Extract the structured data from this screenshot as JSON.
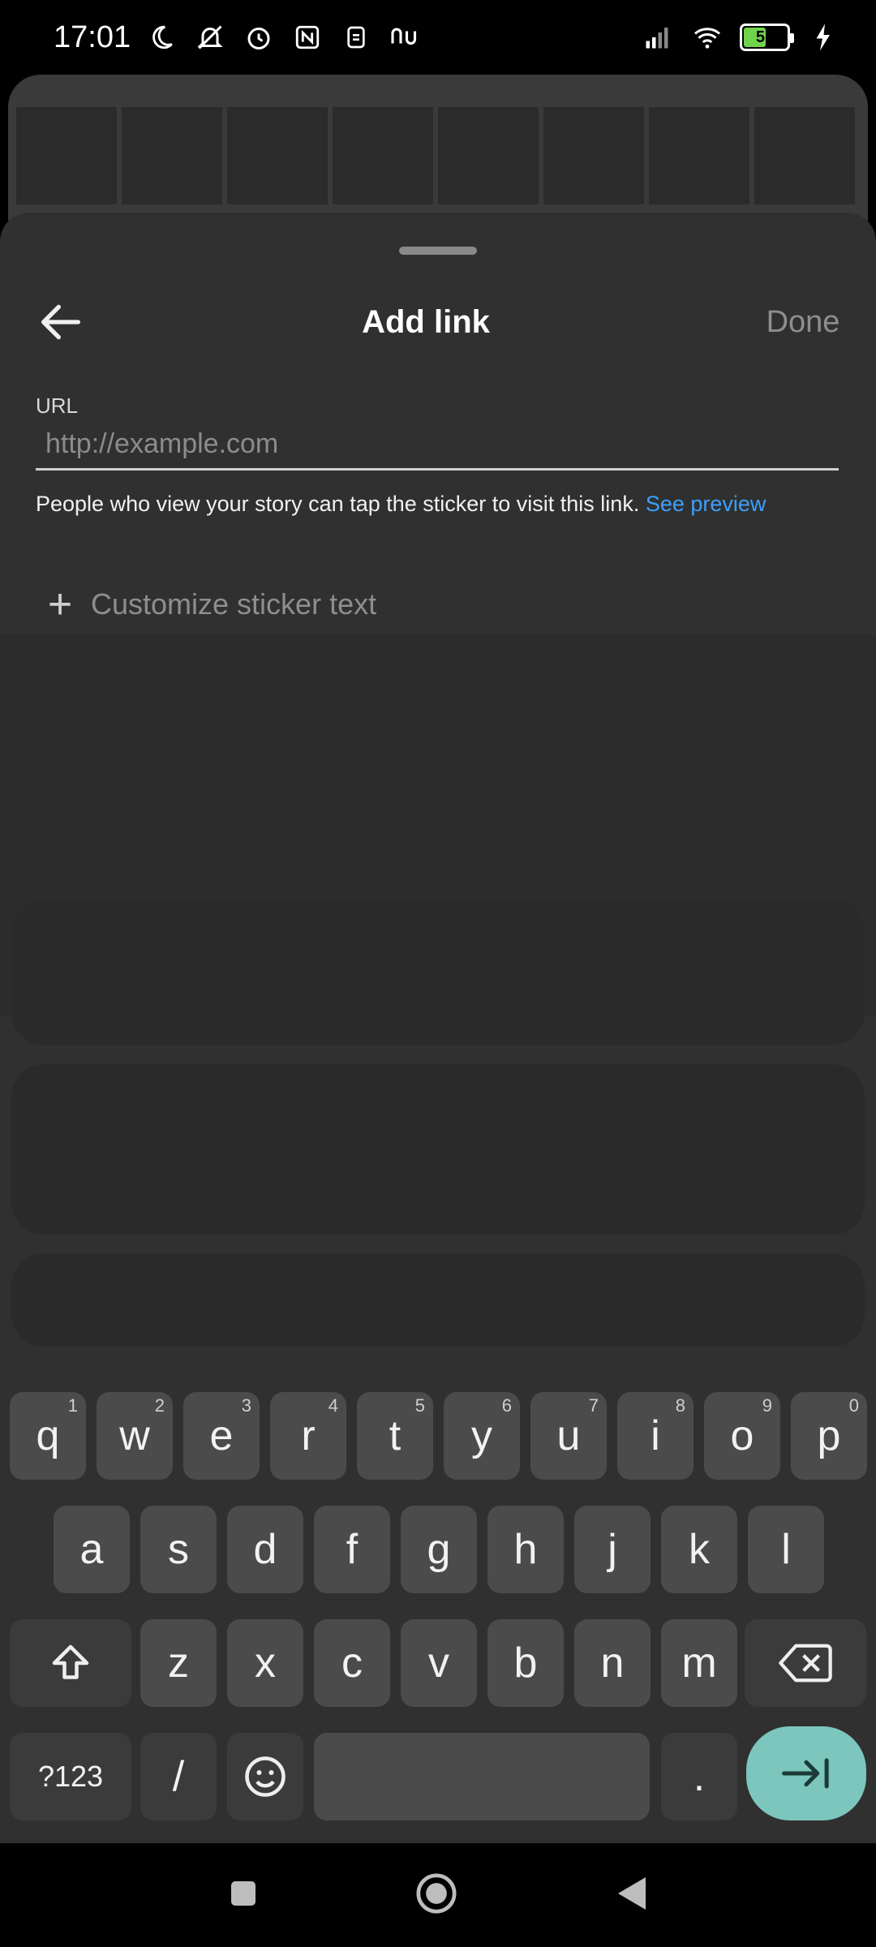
{
  "status_bar": {
    "time": "17:01",
    "battery_percent": "51",
    "icons": [
      "moon-icon",
      "mute-icon",
      "alarm-icon",
      "nfc-icon",
      "sim-icon",
      "nu-icon",
      "signal-icon",
      "wifi-icon",
      "battery-icon",
      "charging-icon"
    ]
  },
  "sheet": {
    "title": "Add link",
    "done_label": "Done",
    "url_label": "URL",
    "url_placeholder": "http://example.com",
    "url_value": "",
    "helper_text": "People who view your story can tap the sticker to visit this link.",
    "preview_link": "See preview",
    "customize_label": "Customize sticker text",
    "plus_glyph": "+"
  },
  "keyboard": {
    "row1": [
      {
        "label": "q",
        "hint": "1"
      },
      {
        "label": "w",
        "hint": "2"
      },
      {
        "label": "e",
        "hint": "3"
      },
      {
        "label": "r",
        "hint": "4"
      },
      {
        "label": "t",
        "hint": "5"
      },
      {
        "label": "y",
        "hint": "6"
      },
      {
        "label": "u",
        "hint": "7"
      },
      {
        "label": "i",
        "hint": "8"
      },
      {
        "label": "o",
        "hint": "9"
      },
      {
        "label": "p",
        "hint": "0"
      }
    ],
    "row2": [
      "a",
      "s",
      "d",
      "f",
      "g",
      "h",
      "j",
      "k",
      "l"
    ],
    "row3": [
      "z",
      "x",
      "c",
      "v",
      "b",
      "n",
      "m"
    ],
    "symbols_label": "?123",
    "slash_label": "/",
    "period_label": "."
  },
  "colors": {
    "accent_link": "#3aa0ff",
    "enter_key": "#7cc6bd",
    "sheet_bg": "#303030"
  }
}
